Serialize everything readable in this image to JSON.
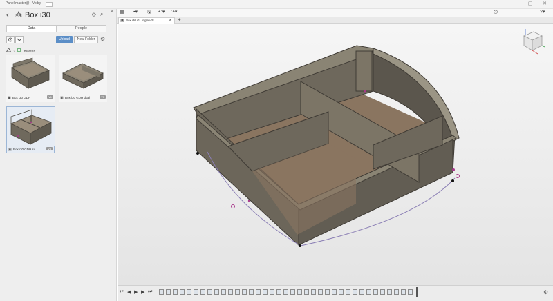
{
  "window": {
    "title": "Panel master@ - Volby",
    "controls": [
      "–",
      "▢",
      "✕"
    ]
  },
  "data_panel": {
    "close_glyph": "✕",
    "back_glyph": "‹",
    "project_icon": "⁂",
    "project_title": "Box i30",
    "refresh_glyph": "⟳",
    "search_glyph": "⌕",
    "tabs": [
      "Data",
      "People"
    ],
    "upload_label": "Upload",
    "new_folder_label": "New Folder",
    "settings_glyph": "⚙",
    "branch_label": "master",
    "files": [
      {
        "label": "Box i30 GDH",
        "version": "V1"
      },
      {
        "label": "Box i30 GDH dual",
        "version": "V3"
      },
      {
        "label": "Box i30 GDH si...",
        "version": "V3"
      }
    ]
  },
  "app_toolbar": {
    "grid_glyph": "▦",
    "file_glyph": "▪▾",
    "save_glyph": "🖫",
    "undo_glyph": "↶▾",
    "redo_glyph": "↷▾",
    "clock_glyph": "◷",
    "help_glyph": "?▾"
  },
  "document_tab": {
    "label": "Box i30 G...ingle v3*",
    "close_glyph": "✕",
    "add_glyph": "+"
  },
  "timeline": {
    "controls": [
      "⏮",
      "◀",
      "▶",
      "▶",
      "⏭"
    ],
    "settings_glyph": "⚙"
  },
  "colors": {
    "upload_accent": "#5b8ec7",
    "model_body": "#7c7566",
    "model_floor": "#8a7560",
    "sketch_point": "#a83a8c"
  }
}
